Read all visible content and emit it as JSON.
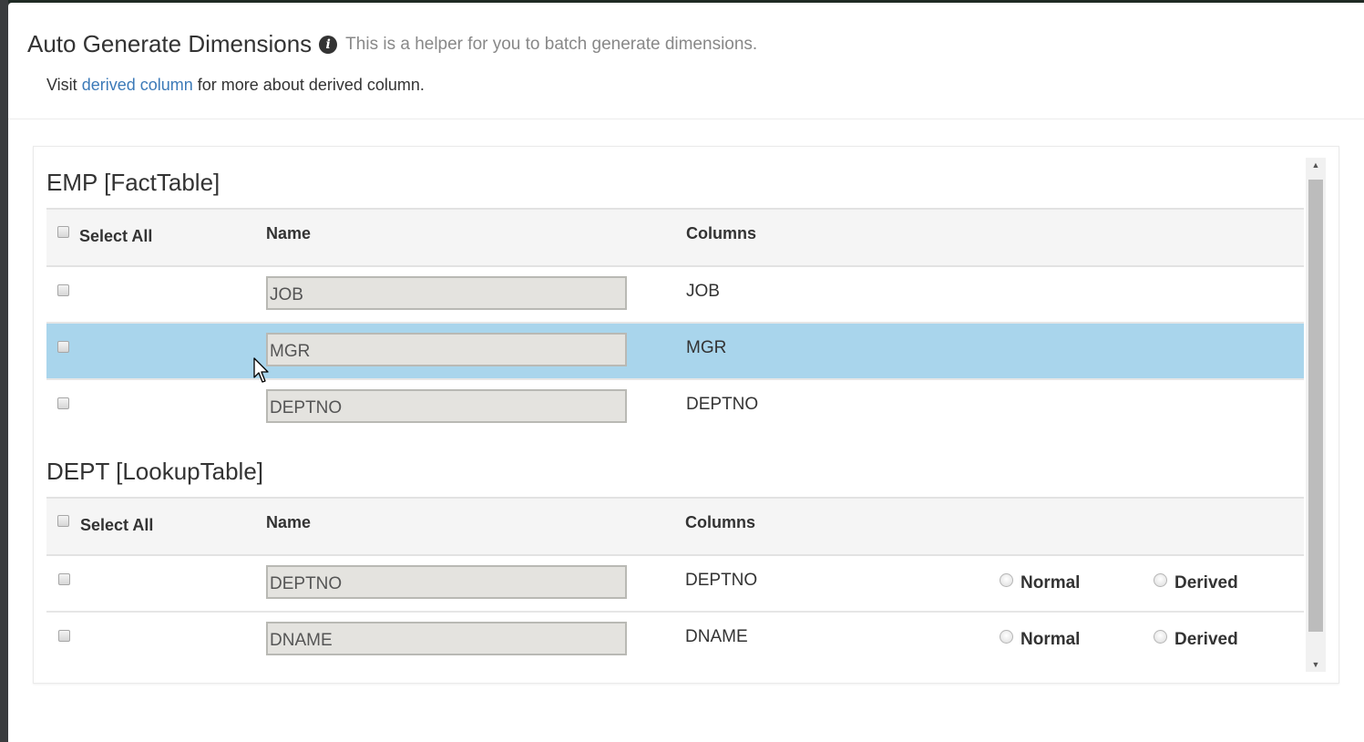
{
  "header": {
    "title": "Auto Generate Dimensions",
    "helper_text": "This is a helper for you to batch generate dimensions.",
    "visit_prefix": "Visit",
    "visit_link": "derived column",
    "visit_suffix": "for more about derived column."
  },
  "fact_table": {
    "title": "EMP [FactTable]",
    "select_all_label": "Select All",
    "name_header": "Name",
    "columns_header": "Columns",
    "rows": [
      {
        "name": "JOB",
        "column": "JOB",
        "checked": false,
        "highlighted": false
      },
      {
        "name": "MGR",
        "column": "MGR",
        "checked": false,
        "highlighted": true
      },
      {
        "name": "DEPTNO",
        "column": "DEPTNO",
        "checked": false,
        "highlighted": false
      }
    ]
  },
  "lookup_table": {
    "title": "DEPT [LookupTable]",
    "select_all_label": "Select All",
    "name_header": "Name",
    "columns_header": "Columns",
    "normal_label": "Normal",
    "derived_label": "Derived",
    "rows": [
      {
        "name": "DEPTNO",
        "column": "DEPTNO",
        "checked": false
      },
      {
        "name": "DNAME",
        "column": "DNAME",
        "checked": false
      }
    ]
  },
  "colors": {
    "highlight_row": "#a9d5ec",
    "link": "#3c7ab8",
    "header_bg": "#f5f5f5"
  }
}
